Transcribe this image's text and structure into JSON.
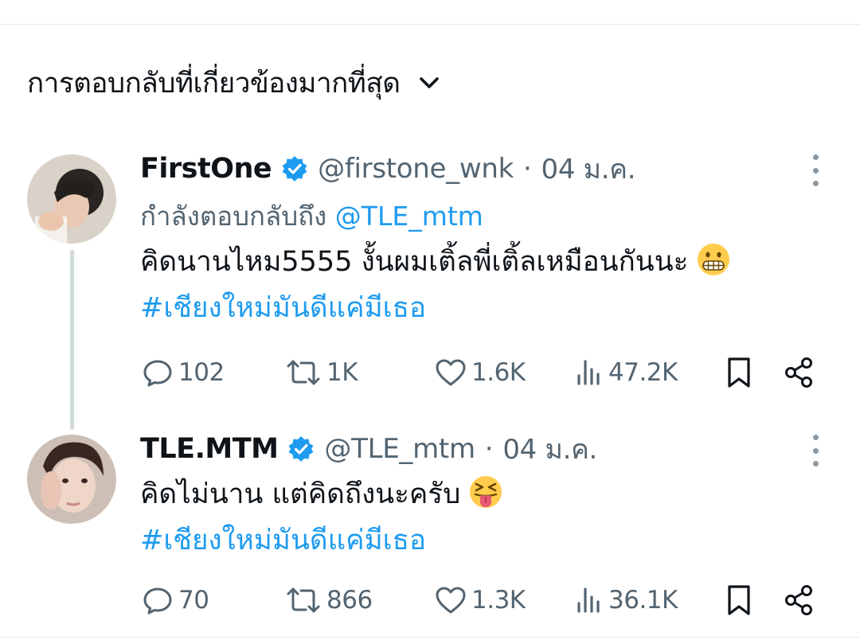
{
  "sort": {
    "label": "การตอบกลับที่เกี่ยวข้องมากที่สุด"
  },
  "replies": [
    {
      "name": "FirstOne",
      "handle": "@firstone_wnk",
      "separator": "·",
      "date": "04 ม.ค.",
      "replying_prefix": "กำลังตอบกลับถึง",
      "replying_to": "@TLE_mtm",
      "text": "คิดนานไหม5555 งั้นผมเติ้ลพี่เติ้ลเหมือนกันนะ",
      "emoji": "grimacing-face",
      "hashtag": "#เชียงใหม่มันดีแค่มีเธอ",
      "stats": {
        "replies": "102",
        "retweets": "1K",
        "likes": "1.6K",
        "views": "47.2K"
      }
    },
    {
      "name": "TLE.MTM",
      "handle": "@TLE_mtm",
      "separator": "·",
      "date": "04 ม.ค.",
      "text": "คิดไม่นาน แต่คิดถึงนะครับ",
      "emoji": "squinting-face-with-tongue",
      "hashtag": "#เชียงใหม่มันดีแค่มีเธอ",
      "stats": {
        "replies": "70",
        "retweets": "866",
        "likes": "1.3K",
        "views": "36.1K"
      }
    }
  ],
  "colors": {
    "accent": "#1d9bf0",
    "secondary": "#536471",
    "thread": "#cfd9de",
    "text": "#0f1419"
  }
}
